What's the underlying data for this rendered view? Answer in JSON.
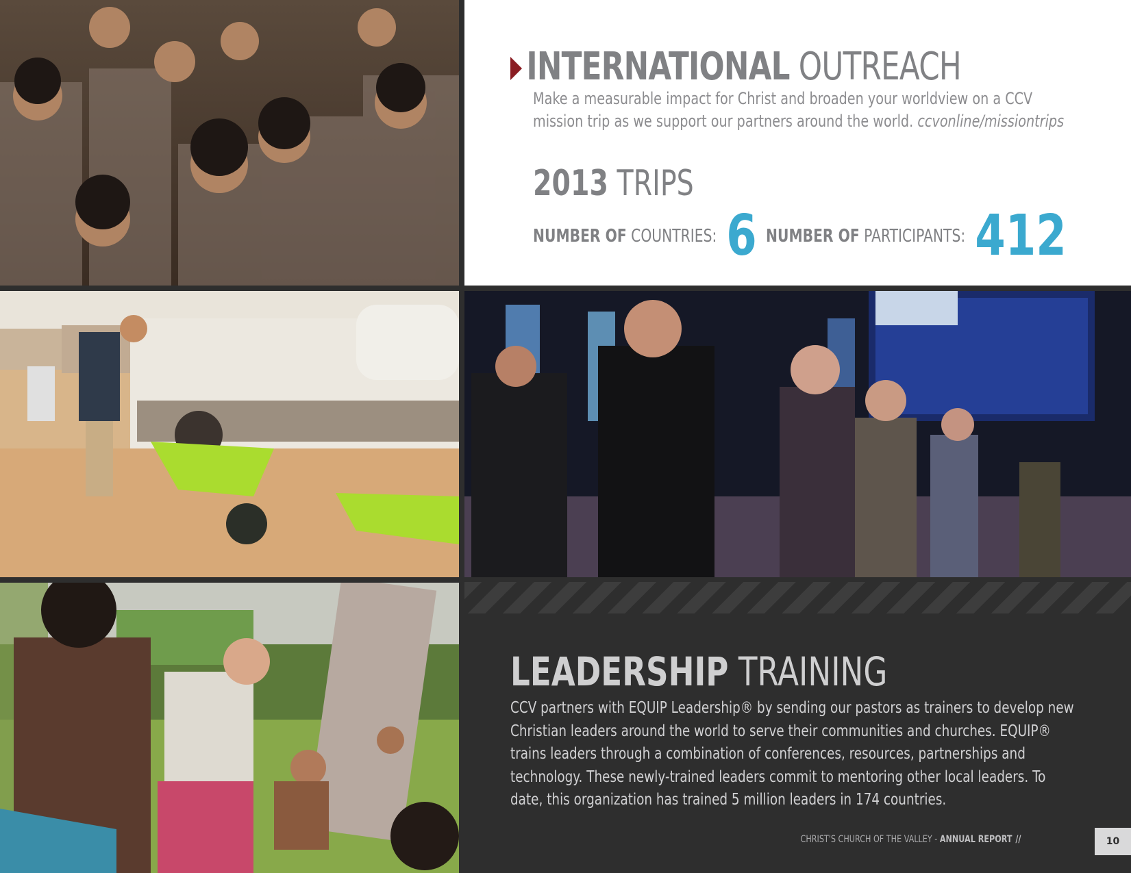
{
  "outreach": {
    "title_bold": "INTERNATIONAL",
    "title_light": "OUTREACH",
    "description": "Make a measurable impact for Christ and broaden your worldview on a CCV mission trip as we support our partners around the world.",
    "url": "ccvonline/missiontrips"
  },
  "trips": {
    "year": "2013",
    "label": "TRIPS",
    "countries": {
      "label_bold": "NUMBER OF",
      "label_light": "COUNTRIES:",
      "value": "6"
    },
    "participants": {
      "label_bold": "NUMBER OF",
      "label_light": "PARTICIPANTS:",
      "value": "412"
    }
  },
  "leadership": {
    "title_bold": "LEADERSHIP",
    "title_light": "TRAINING",
    "description": "CCV partners with EQUIP Leadership® by sending our pastors as trainers to develop new Christian leaders around the world to serve their communities and churches. EQUIP® trains leaders through a combination of conferences, resources, partnerships and technology. These newly-trained leaders commit to mentoring other local leaders. To date, this organization has trained 5 million leaders in 174 countries."
  },
  "footer": {
    "org": "CHRIST'S CHURCH OF THE VALLEY -",
    "report": "ANNUAL REPORT",
    "separator": "//",
    "page_number": "10"
  },
  "colors": {
    "accent_blue": "#3ba9cf",
    "marker_red": "#8a1c22",
    "background_dark": "#2e2e2e"
  }
}
